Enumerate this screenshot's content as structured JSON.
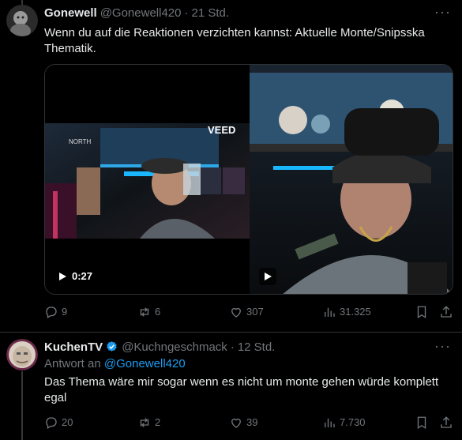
{
  "tweet1": {
    "name": "Gonewell",
    "handle": "@Gonewell420",
    "time": "21 Std.",
    "text": "Wenn du auf die Reaktionen verzichten kannst: Aktuelle Monte/Snipsska Thematik.",
    "video": {
      "duration": "0:27",
      "overlay_label": "VEED"
    },
    "stats": {
      "replies": "9",
      "reposts": "6",
      "likes": "307",
      "views": "31.325"
    }
  },
  "tweet2": {
    "name": "KuchenTV",
    "handle": "@Kuchngeschmack",
    "time": "12 Std.",
    "reply_prefix": "Antwort an",
    "reply_target": "@Gonewell420",
    "text": "Das Thema wäre mir sogar wenn es nicht um monte gehen würde komplett egal",
    "stats": {
      "replies": "20",
      "reposts": "2",
      "likes": "39",
      "views": "7.730"
    }
  },
  "colors": {
    "accent": "#1d9bf0",
    "muted": "#71767b",
    "text": "#e7e9ea",
    "background": "#000000"
  },
  "icons": [
    "more-icon",
    "reply-icon",
    "repost-icon",
    "like-icon",
    "views-icon",
    "bookmark-icon",
    "share-icon",
    "play-icon",
    "verified-badge-icon"
  ]
}
